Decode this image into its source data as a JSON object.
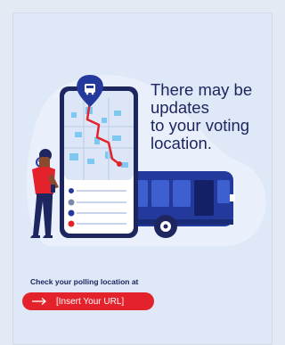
{
  "headline": {
    "lines": [
      "There may be",
      "updates",
      "to your voting",
      "location."
    ]
  },
  "footer": {
    "check_label": "Check your polling location at",
    "url_button_label": "[Insert Your URL]"
  },
  "colors": {
    "navy": "#1e2660",
    "bus_blue": "#233a9c",
    "accent_red": "#e3222b",
    "map_light_blue": "#7fc8f2",
    "card_background": "#dfe8f7"
  },
  "icons": {
    "pin": "bus-location-pin-icon",
    "arrow": "arrow-right-icon"
  }
}
